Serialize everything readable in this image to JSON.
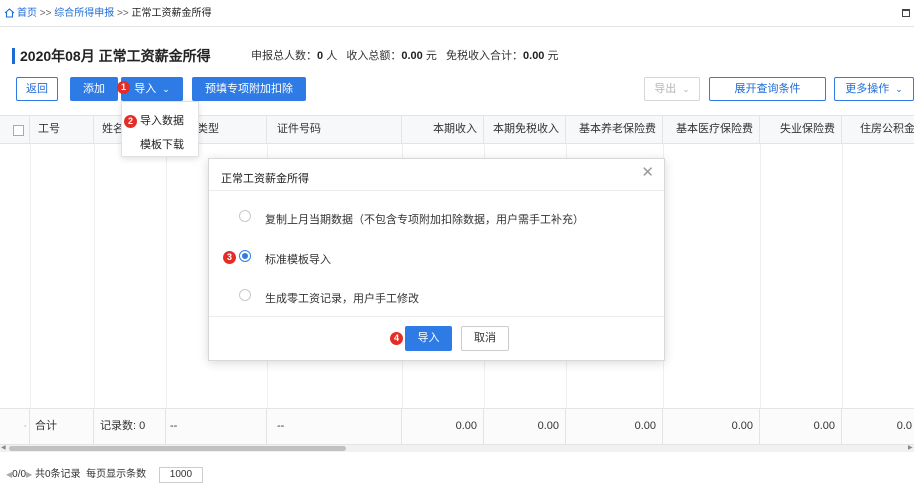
{
  "breadcrumb": {
    "home": "首页",
    "sep": ">>",
    "item1": "综合所得申报",
    "current": "正常工资薪金所得"
  },
  "header": {
    "title": "2020年08月 正常工资薪金所得",
    "summary_label1": "申报总人数：",
    "summary_value1": "0",
    "summary_unit1": "人",
    "summary_label2": "收入总额：",
    "summary_value2": "0.00",
    "summary_unit2": "元",
    "summary_label3": "免税收入合计：",
    "summary_value3": "0.00",
    "summary_unit3": "元"
  },
  "toolbar": {
    "back": "返回",
    "add": "添加",
    "import": "导入",
    "prefill": "预填专项附加扣除",
    "export": "导出",
    "expand_query": "展开查询条件",
    "more": "更多操作"
  },
  "import_menu": {
    "items": [
      "导入数据",
      "模板下载"
    ]
  },
  "table": {
    "columns": [
      "工号",
      "姓名",
      "类型",
      "证件号码",
      "本期收入",
      "本期免税收入",
      "基本养老保险费",
      "基本医疗保险费",
      "失业保险费",
      "住房公积金"
    ],
    "total_row": {
      "label": "合计",
      "records": "记录数: 0",
      "cert_type": "--",
      "cert_no": "--",
      "values": [
        "0.00",
        "0.00",
        "0.00",
        "0.00",
        "0.00",
        "0.0"
      ]
    }
  },
  "pager": {
    "range": "0/0",
    "total": "共0条记录",
    "per_page_label": "每页显示条数",
    "per_page": "1000"
  },
  "dialog": {
    "title": "正常工资薪金所得",
    "options": [
      "复制上月当期数据（不包含专项附加扣除数据，用户需手工补充）",
      "标准模板导入",
      "生成零工资记录，用户手工修改"
    ],
    "selected_index": 1,
    "confirm": "导入",
    "cancel": "取消"
  },
  "badges": [
    "1",
    "2",
    "3",
    "4"
  ],
  "colors": {
    "accent": "#2f7be6",
    "badge": "#e52d27"
  }
}
